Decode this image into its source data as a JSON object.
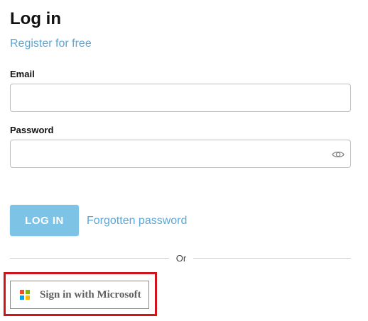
{
  "login": {
    "title": "Log in",
    "register_link": "Register for free",
    "email": {
      "label": "Email",
      "value": "",
      "placeholder": ""
    },
    "password": {
      "label": "Password",
      "value": "",
      "placeholder": "",
      "toggle_icon": "eye-icon"
    },
    "login_button": "LOG IN",
    "forgot_link": "Forgotten password",
    "divider_text": "Or",
    "microsoft_button": {
      "label": "Sign in with Microsoft",
      "icon": "microsoft-logo-icon"
    }
  },
  "colors": {
    "link": "#5aa7d8",
    "login_button_bg": "#7cc3e6",
    "highlight_frame": "#d0141c",
    "ms_red": "#f25022",
    "ms_green": "#7fba00",
    "ms_blue": "#00a4ef",
    "ms_yellow": "#ffb900"
  }
}
